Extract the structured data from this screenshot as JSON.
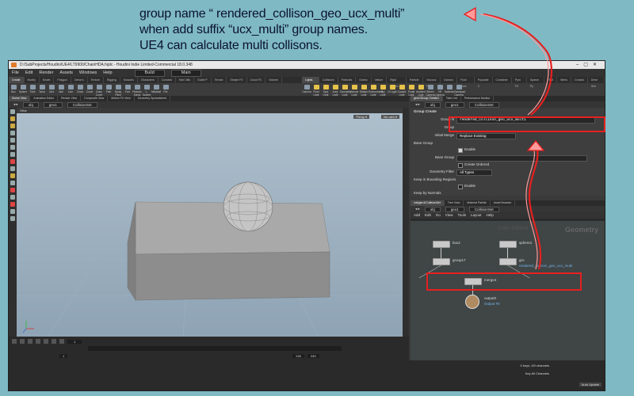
{
  "annotation": {
    "line1": "group name “ rendered_collison_geo_ucx_multi”",
    "line2": "when add suffix “ucx_multi” group names.",
    "line3": "UE4 can calculate multi collisons."
  },
  "window": {
    "title": "D:/SubProjects/Houdini/UE4/LT9900/ChainHDA.hiplc - Houdini Indie Limited-Commercial 18.0.348"
  },
  "menu": {
    "items": [
      "File",
      "Edit",
      "Render",
      "Assets",
      "Windows",
      "Help"
    ],
    "build": "Build",
    "main": "Main"
  },
  "shelf_tabs": [
    "Create",
    "Modify",
    "Model",
    "Polygon",
    "Deform",
    "Texture",
    "Rigging",
    "Muscles",
    "Characters",
    "Constrai",
    "Hair Utils",
    "Guide P",
    "Terrain",
    "Simple FX",
    "Cloud FX",
    "Volume"
  ],
  "shelf_tools": [
    "Box",
    "Sphere",
    "Tube",
    "Torus",
    "Grid",
    "Null",
    "Line",
    "Circle",
    "Curve",
    "Draw Curve",
    "Path",
    "Spray Paint",
    "Font",
    "Platonic Solids",
    "L-System",
    "Metaball",
    "File"
  ],
  "light_tabs": [
    "Lights and",
    "Collisions",
    "Particles",
    "Grains",
    "Vellum",
    "Rigid Bodies",
    "Particle Fl",
    "Viscous Fl",
    "Oceans",
    "Fluid Cont",
    "Populate C",
    "Container",
    "Pyro FX",
    "Sparse Py",
    "FEM",
    "Wires",
    "Crowds",
    "Drive Sim"
  ],
  "light_tools": [
    "Camera",
    "Point Light",
    "Spot Light",
    "Area Light",
    "Geometry Light",
    "Volume Light",
    "Distant Light",
    "Environment Light",
    "Sky Light",
    "GI Light",
    "Caustic Light",
    "Portal Light",
    "Ambient Light",
    "Stereo Camera",
    "VR Camera",
    "Switcher",
    "Gamepad Camera"
  ],
  "left_pane_tabs": [
    "Scene View",
    "Animation Editor",
    "Render View",
    "Composite View",
    "Motion FX View",
    "Geometry Spreadsheet"
  ],
  "left_path": [
    "obj",
    "geo1"
  ],
  "left_node": "CollisionSet",
  "viewport": {
    "title": "View",
    "persp": "Persp ▾",
    "cam": "No cam ▾"
  },
  "timeline": {
    "frame": "1",
    "start": "1",
    "end1": "240",
    "end2": "240",
    "keys": "0 keys, 0/0 channels",
    "channels": "Key All Channels",
    "auto_update": "Auto Update"
  },
  "right_pane_tabs": [
    "geo1/Group Create1",
    "Take List",
    "Performance Monitor"
  ],
  "right_path": [
    "obj",
    "geo1"
  ],
  "right_node": "CollisionSet",
  "params": {
    "header": "Group Create",
    "group_name_label": "Group N",
    "group_name_value": "rendered_collison_geo_ucx_multi",
    "group_type_label": "Group",
    "initial_merge_label": "Initial Merge",
    "initial_merge_value": "Replace Existing",
    "base_group_section": "Base Group",
    "enable_label": "Enable",
    "base_group_label": "Base Group",
    "create_ordered_label": "Create Ordered",
    "geometry_filter_label": "Geometry Filter",
    "geometry_filter_value": "All Types",
    "bounding_section": "Keep in Bounding Regions",
    "enable2_label": "Enable",
    "normals_section": "Keep by Normals"
  },
  "net_tabs": [
    "/obj/geo1/CollisionSet",
    "Tree View",
    "Material Palette",
    "Asset Browser"
  ],
  "net_path": [
    "obj",
    "geo1"
  ],
  "net_node": "CollisionSet",
  "net_menu": [
    "Add",
    "Edit",
    "Go",
    "View",
    "Tools",
    "Layout",
    "Help"
  ],
  "network": {
    "watermark_indie": "Indie Edition",
    "watermark_geo": "Geometry",
    "nodes": {
      "box2": "box2",
      "sphere1": "sphere1",
      "group17": "group17",
      "group_right": "gro",
      "group_right_param": "rendered_collison_geo_ucx_multi",
      "merge4": "merge4",
      "output0": "output0",
      "output_sub": "Output #0"
    }
  },
  "colors": {
    "annotation_red": "#e62020",
    "background": "#7fb9c4"
  }
}
